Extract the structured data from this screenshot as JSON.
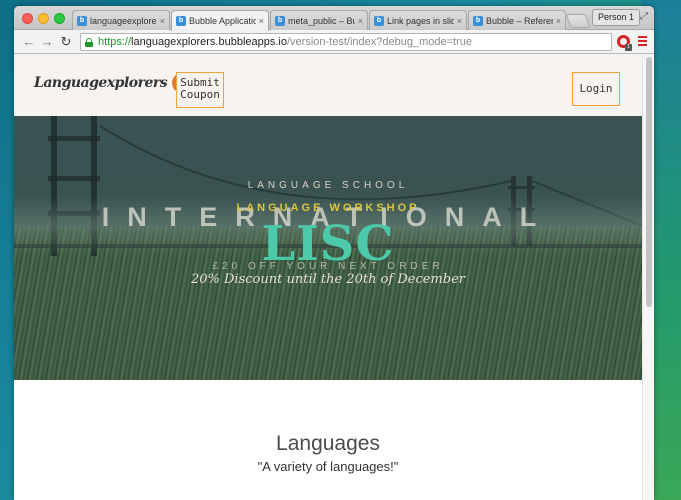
{
  "browser": {
    "tabs": [
      {
        "label": "languageexplorers",
        "close": "×"
      },
      {
        "label": "Bubble Application",
        "close": "×"
      },
      {
        "label": "meta_public – Bubb",
        "close": "×"
      },
      {
        "label": "Link pages in slide",
        "close": "×"
      },
      {
        "label": "Bubble – Reference",
        "close": "×"
      }
    ],
    "active_tab": 1,
    "profile_label": "Person 1",
    "url_scheme": "https://",
    "url_host": "languagexplorers.bubbleapps.io",
    "url_path": "/version-test/index?debug_mode=true",
    "badge_count": "1",
    "icons": [
      "back-arrow-icon",
      "forward-arrow-icon",
      "reload-icon",
      "lock-icon",
      "star-icon",
      "opera-icon",
      "menu-icon"
    ]
  },
  "header": {
    "logo_text": "Languagexplorers",
    "coupon_button": "Submit\nCoupon",
    "login_button": "Login",
    "accent_color": "#f0a13a"
  },
  "hero": {
    "line_school": "LANGUAGE SCHOOL",
    "line_international": "INTERNATIONAL",
    "line_workshop": "LANGUAGE WORKSHOP",
    "line_lisc": "LISC",
    "line_off": "£20 OFF YOUR NEXT ORDER",
    "line_discount": "20% Discount until the 20th of December"
  },
  "languages": {
    "title": "Languages",
    "subtitle": "\"A variety of languages!\""
  }
}
